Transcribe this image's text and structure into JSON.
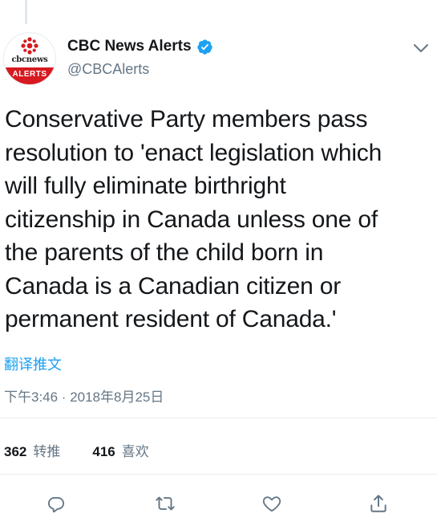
{
  "tweet": {
    "author_name": "CBC News Alerts",
    "handle": "@CBCAlerts",
    "avatar": {
      "wordmark": "cbcnews",
      "band_text": "ALERTS",
      "accent": "#d71920"
    },
    "verified": true,
    "text_lines": [
      "Conservative Party members pass",
      "resolution to 'enact legislation which",
      "will fully eliminate birthright",
      "citizenship in Canada unless one of",
      "the parents of the child born in",
      "Canada is a Canadian citizen or",
      "permanent resident of Canada.'"
    ],
    "translate_link": "翻译推文",
    "timestamp": "下午3:46 · 2018年8月25日",
    "stats": {
      "retweets_count": "362",
      "retweets_label": "转推",
      "likes_count": "416",
      "likes_label": "喜欢"
    }
  },
  "actions": [
    {
      "icon": "reply-icon"
    },
    {
      "icon": "retweet-icon"
    },
    {
      "icon": "like-icon"
    },
    {
      "icon": "share-icon"
    }
  ],
  "colors": {
    "link": "#1da1f2",
    "muted": "#657786",
    "text": "#14171a",
    "divider": "#e6ecf0"
  }
}
